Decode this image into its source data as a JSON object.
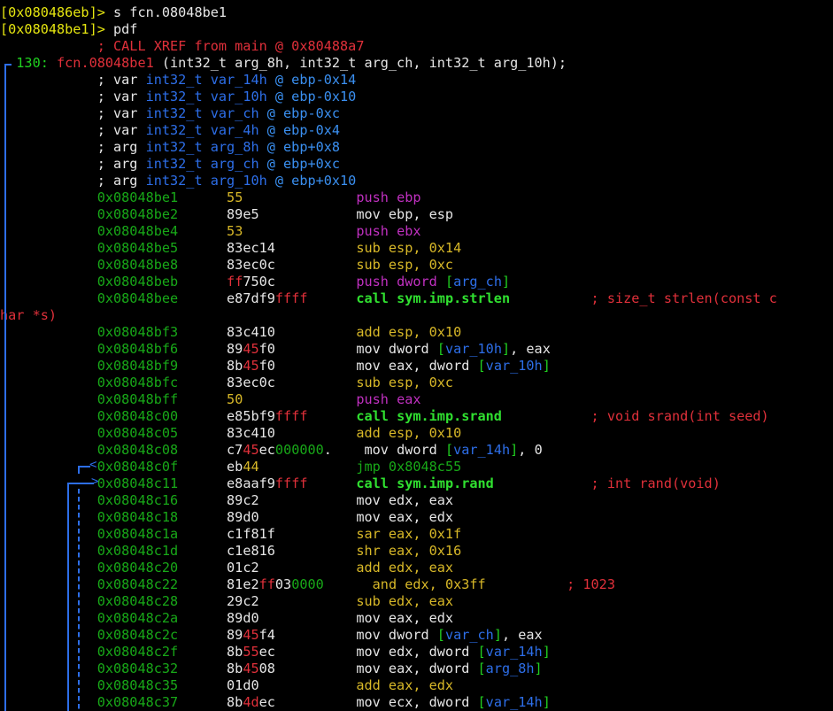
{
  "terminal": {
    "lines": [
      [
        [
          "[0x080486eb]> ",
          "prompt"
        ],
        [
          "s fcn.08048be1",
          "white"
        ]
      ],
      [
        [
          "[0x08048be1]> ",
          "prompt"
        ],
        [
          "pdf",
          "white"
        ]
      ],
      [
        [
          "            ; CALL XREF from main @ 0x80488a7",
          "red"
        ]
      ],
      [
        [
          "  130: ",
          "green"
        ],
        [
          "fcn.08048be1",
          "red"
        ],
        [
          " (int32_t arg_8h, int32_t arg_ch, int32_t arg_10h);",
          "white"
        ]
      ],
      [
        [
          "            ; var ",
          "white"
        ],
        [
          "int32_t var_14h",
          "dblue"
        ],
        [
          " @ ebp-0x14",
          "blue"
        ]
      ],
      [
        [
          "            ; var ",
          "white"
        ],
        [
          "int32_t var_10h",
          "dblue"
        ],
        [
          " @ ebp-0x10",
          "blue"
        ]
      ],
      [
        [
          "            ; var ",
          "white"
        ],
        [
          "int32_t var_ch",
          "dblue"
        ],
        [
          " @ ebp-0xc",
          "blue"
        ]
      ],
      [
        [
          "            ; var ",
          "white"
        ],
        [
          "int32_t var_4h",
          "dblue"
        ],
        [
          " @ ebp-0x4",
          "blue"
        ]
      ],
      [
        [
          "            ; arg ",
          "white"
        ],
        [
          "int32_t arg_8h",
          "dblue"
        ],
        [
          " @ ebp+0x8",
          "blue"
        ]
      ],
      [
        [
          "            ; arg ",
          "white"
        ],
        [
          "int32_t arg_ch",
          "dblue"
        ],
        [
          " @ ebp+0xc",
          "blue"
        ]
      ],
      [
        [
          "            ; arg ",
          "white"
        ],
        [
          "int32_t arg_10h",
          "dblue"
        ],
        [
          " @ ebp+0x10",
          "blue"
        ]
      ],
      [
        [
          "            0x08048be1",
          "dgreen"
        ],
        [
          "      ",
          "white"
        ],
        [
          "55",
          "yellow"
        ],
        [
          "              ",
          "white"
        ],
        [
          "push ebp",
          "purple"
        ]
      ],
      [
        [
          "            0x08048be2",
          "dgreen"
        ],
        [
          "      89e5            ",
          "white"
        ],
        [
          "mov ebp, esp",
          "white"
        ]
      ],
      [
        [
          "            0x08048be4",
          "dgreen"
        ],
        [
          "      ",
          "white"
        ],
        [
          "53",
          "yellow"
        ],
        [
          "              ",
          "white"
        ],
        [
          "push ebx",
          "purple"
        ]
      ],
      [
        [
          "            0x08048be5",
          "dgreen"
        ],
        [
          "      83ec14          ",
          "white"
        ],
        [
          "sub esp, 0x14",
          "yellow"
        ]
      ],
      [
        [
          "            0x08048be8",
          "dgreen"
        ],
        [
          "      83ec0c          ",
          "white"
        ],
        [
          "sub esp, 0xc",
          "yellow"
        ]
      ],
      [
        [
          "            0x08048beb",
          "dgreen"
        ],
        [
          "      ",
          "white"
        ],
        [
          "ff",
          "red"
        ],
        [
          "750c",
          "white"
        ],
        [
          "          ",
          "white"
        ],
        [
          "push dword ",
          "purple"
        ],
        [
          "[",
          "green"
        ],
        [
          "arg_ch",
          "dblue"
        ],
        [
          "]",
          "green"
        ]
      ],
      [
        [
          "            0x08048bee",
          "dgreen"
        ],
        [
          "      e87df9",
          "white"
        ],
        [
          "ffff",
          "red"
        ],
        [
          "      ",
          "white"
        ],
        [
          "call sym.imp.strlen",
          "bold"
        ],
        [
          "          ; size_t strlen(const c",
          "red"
        ]
      ],
      [
        [
          "har *s)",
          "red"
        ]
      ],
      [
        [
          "            0x08048bf3",
          "dgreen"
        ],
        [
          "      83c410          ",
          "white"
        ],
        [
          "add esp, 0x10",
          "yellow"
        ]
      ],
      [
        [
          "            0x08048bf6",
          "dgreen"
        ],
        [
          "      89",
          "white"
        ],
        [
          "45",
          "red"
        ],
        [
          "f0          ",
          "white"
        ],
        [
          "mov dword ",
          "white"
        ],
        [
          "[",
          "green"
        ],
        [
          "var_10h",
          "dblue"
        ],
        [
          "]",
          "green"
        ],
        [
          ", eax",
          "white"
        ]
      ],
      [
        [
          "            0x08048bf9",
          "dgreen"
        ],
        [
          "      8b",
          "white"
        ],
        [
          "45",
          "red"
        ],
        [
          "f0          ",
          "white"
        ],
        [
          "mov eax, dword ",
          "white"
        ],
        [
          "[",
          "green"
        ],
        [
          "var_10h",
          "dblue"
        ],
        [
          "]",
          "green"
        ]
      ],
      [
        [
          "            0x08048bfc",
          "dgreen"
        ],
        [
          "      83ec0c          ",
          "white"
        ],
        [
          "sub esp, 0xc",
          "yellow"
        ]
      ],
      [
        [
          "            0x08048bff",
          "dgreen"
        ],
        [
          "      ",
          "white"
        ],
        [
          "50",
          "yellow"
        ],
        [
          "              ",
          "white"
        ],
        [
          "push eax",
          "purple"
        ]
      ],
      [
        [
          "            0x08048c00",
          "dgreen"
        ],
        [
          "      e85bf9",
          "white"
        ],
        [
          "ffff",
          "red"
        ],
        [
          "      ",
          "white"
        ],
        [
          "call sym.imp.srand",
          "bold"
        ],
        [
          "           ; void srand(int seed)",
          "red"
        ]
      ],
      [
        [
          "            0x08048c05",
          "dgreen"
        ],
        [
          "      83c410          ",
          "white"
        ],
        [
          "add esp, 0x10",
          "yellow"
        ]
      ],
      [
        [
          "            0x08048c08",
          "dgreen"
        ],
        [
          "      c7",
          "white"
        ],
        [
          "45",
          "red"
        ],
        [
          "ec",
          "white"
        ],
        [
          "000000",
          "dgreen"
        ],
        [
          ".    ",
          "white"
        ],
        [
          "mov dword ",
          "white"
        ],
        [
          "[",
          "green"
        ],
        [
          "var_14h",
          "dblue"
        ],
        [
          "]",
          "green"
        ],
        [
          ", 0",
          "white"
        ]
      ],
      [
        [
          "            0x08048c0f",
          "dgreen"
        ],
        [
          "      eb",
          "white"
        ],
        [
          "44",
          "yellow"
        ],
        [
          "            ",
          "white"
        ],
        [
          "jmp 0x8048c55",
          "dgreen"
        ]
      ],
      [
        [
          "            0x08048c11",
          "dgreen"
        ],
        [
          "      e8aaf9",
          "white"
        ],
        [
          "ffff",
          "red"
        ],
        [
          "      ",
          "white"
        ],
        [
          "call sym.imp.rand",
          "bold"
        ],
        [
          "            ; int rand(void)",
          "red"
        ]
      ],
      [
        [
          "            0x08048c16",
          "dgreen"
        ],
        [
          "      89c2            ",
          "white"
        ],
        [
          "mov edx, eax",
          "white"
        ]
      ],
      [
        [
          "            0x08048c18",
          "dgreen"
        ],
        [
          "      89d0            ",
          "white"
        ],
        [
          "mov eax, edx",
          "white"
        ]
      ],
      [
        [
          "            0x08048c1a",
          "dgreen"
        ],
        [
          "      c1f81f          ",
          "white"
        ],
        [
          "sar eax, 0x1f",
          "yellow"
        ]
      ],
      [
        [
          "            0x08048c1d",
          "dgreen"
        ],
        [
          "      c1e816          ",
          "white"
        ],
        [
          "shr eax, 0x16",
          "yellow"
        ]
      ],
      [
        [
          "            0x08048c20",
          "dgreen"
        ],
        [
          "      01c2            ",
          "white"
        ],
        [
          "add edx, eax",
          "yellow"
        ]
      ],
      [
        [
          "            0x08048c22",
          "dgreen"
        ],
        [
          "      81e2",
          "white"
        ],
        [
          "ff",
          "red"
        ],
        [
          "03",
          "white"
        ],
        [
          "0000",
          "dgreen"
        ],
        [
          "      ",
          "white"
        ],
        [
          "and edx, 0x3ff",
          "yellow"
        ],
        [
          "          ; 1023",
          "red"
        ]
      ],
      [
        [
          "            0x08048c28",
          "dgreen"
        ],
        [
          "      29c2            ",
          "white"
        ],
        [
          "sub edx, eax",
          "yellow"
        ]
      ],
      [
        [
          "            0x08048c2a",
          "dgreen"
        ],
        [
          "      89d0            ",
          "white"
        ],
        [
          "mov eax, edx",
          "white"
        ]
      ],
      [
        [
          "            0x08048c2c",
          "dgreen"
        ],
        [
          "      89",
          "white"
        ],
        [
          "45",
          "red"
        ],
        [
          "f4          ",
          "white"
        ],
        [
          "mov dword ",
          "white"
        ],
        [
          "[",
          "green"
        ],
        [
          "var_ch",
          "dblue"
        ],
        [
          "]",
          "green"
        ],
        [
          ", eax",
          "white"
        ]
      ],
      [
        [
          "            0x08048c2f",
          "dgreen"
        ],
        [
          "      8b",
          "white"
        ],
        [
          "55",
          "red"
        ],
        [
          "ec          ",
          "white"
        ],
        [
          "mov edx, dword ",
          "white"
        ],
        [
          "[",
          "green"
        ],
        [
          "var_14h",
          "dblue"
        ],
        [
          "]",
          "green"
        ]
      ],
      [
        [
          "            0x08048c32",
          "dgreen"
        ],
        [
          "      8b",
          "white"
        ],
        [
          "45",
          "red"
        ],
        [
          "08          ",
          "white"
        ],
        [
          "mov eax, dword ",
          "white"
        ],
        [
          "[",
          "green"
        ],
        [
          "arg_8h",
          "dblue"
        ],
        [
          "]",
          "green"
        ]
      ],
      [
        [
          "            0x08048c35",
          "dgreen"
        ],
        [
          "      01d0            ",
          "white"
        ],
        [
          "add eax, edx",
          "yellow"
        ]
      ],
      [
        [
          "            0x08048c37",
          "dgreen"
        ],
        [
          "      8b",
          "white"
        ],
        [
          "4d",
          "red"
        ],
        [
          "ec          ",
          "white"
        ],
        [
          "mov ecx, dword ",
          "white"
        ],
        [
          "[",
          "green"
        ],
        [
          "var_14h",
          "dblue"
        ],
        [
          "]",
          "green"
        ]
      ]
    ]
  },
  "flow_graph": {
    "jump_marker": "<",
    "target_marker": ">"
  },
  "colors": {
    "background": "#000000",
    "prompt": "#e5e510",
    "address": "#18a818",
    "comment": "#e0303a",
    "variable": "#2d6ee8",
    "branch_line": "#2d6ee8"
  }
}
